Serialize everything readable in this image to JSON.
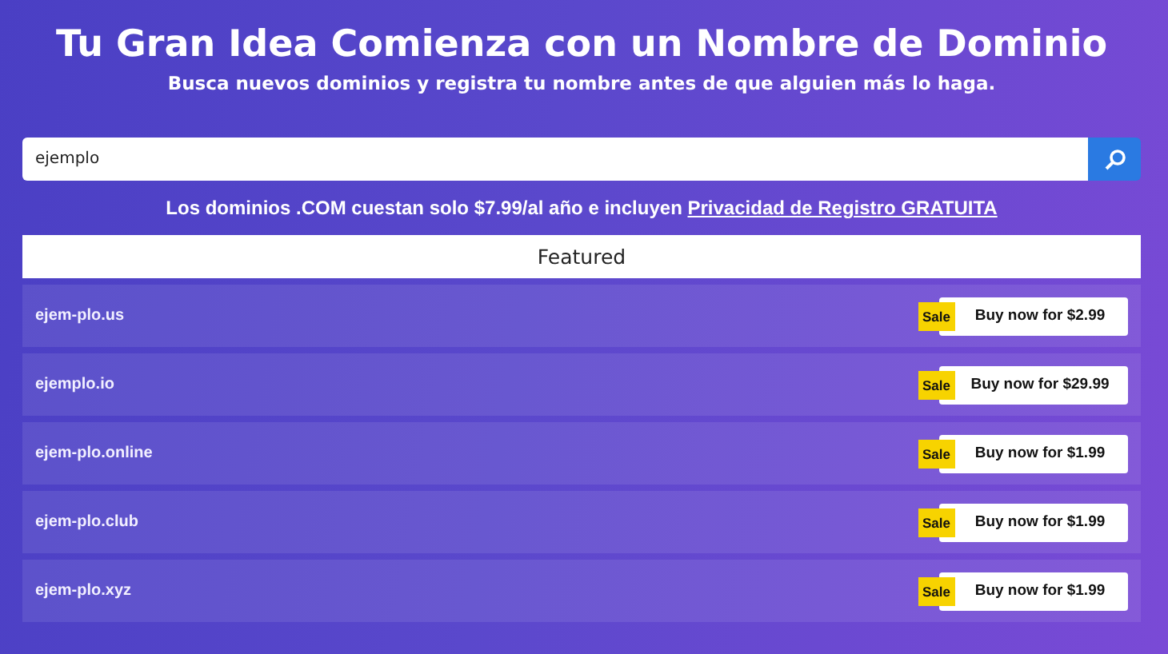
{
  "header": {
    "title": "Tu Gran Idea Comienza con un Nombre de Dominio",
    "subtitle": "Busca nuevos dominios y registra tu nombre antes de que alguien más lo haga."
  },
  "search": {
    "value": "ejemplo"
  },
  "notice": {
    "text": "Los dominios .COM cuestan solo $7.99/al año e incluyen",
    "link": "Privacidad de Registro GRATUITA"
  },
  "featured": {
    "heading": "Featured",
    "rows": [
      {
        "domain": "ejem-plo.us",
        "badge": "Sale",
        "button": "Buy now for $2.99"
      },
      {
        "domain": "ejemplo.io",
        "badge": "Sale",
        "button": "Buy now for $29.99"
      },
      {
        "domain": "ejem-plo.online",
        "badge": "Sale",
        "button": "Buy now for $1.99"
      },
      {
        "domain": "ejem-plo.club",
        "badge": "Sale",
        "button": "Buy now for $1.99"
      },
      {
        "domain": "ejem-plo.xyz",
        "badge": "Sale",
        "button": "Buy now for $1.99"
      }
    ]
  }
}
